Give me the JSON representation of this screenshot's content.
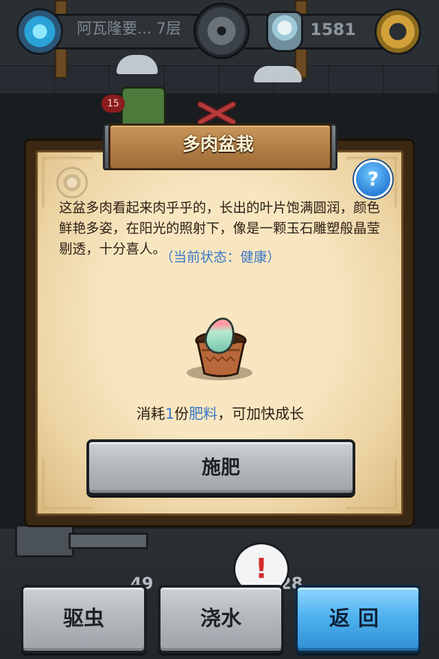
{
  "hud": {
    "location": "阿瓦隆要... 7层",
    "currency": "1581"
  },
  "character": {
    "level": "15"
  },
  "modal": {
    "title": "多肉盆栽",
    "help_symbol": "?",
    "description": "这盆多肉看起来肉乎乎的，长出的叶片饱满圆润，颜色鲜艳多姿，在阳光的照射下，像是一颗玉石雕塑般晶莹剔透，十分喜人。",
    "state": "（当前状态：健康）",
    "consume": {
      "prefix": "消耗",
      "amount": "1",
      "unit": "份",
      "item": "肥料",
      "suffix": "，可加快成长"
    },
    "fertilize_label": "施肥"
  },
  "bottom": {
    "counter_left": "49",
    "counter_right": "28",
    "alert_symbol": "!",
    "buttons": {
      "bug": "驱虫",
      "water": "浇水",
      "back": "返回"
    }
  },
  "colors": {
    "highlight_blue": "#3b78c8",
    "back_button": "#4fb2f0",
    "parchment": "#f7e6c0"
  },
  "icons": [
    "portal-icon",
    "medal-icon",
    "gem-icon",
    "gear-icon",
    "help-icon",
    "badge-icon",
    "succulent-pot-icon",
    "alert-icon"
  ]
}
